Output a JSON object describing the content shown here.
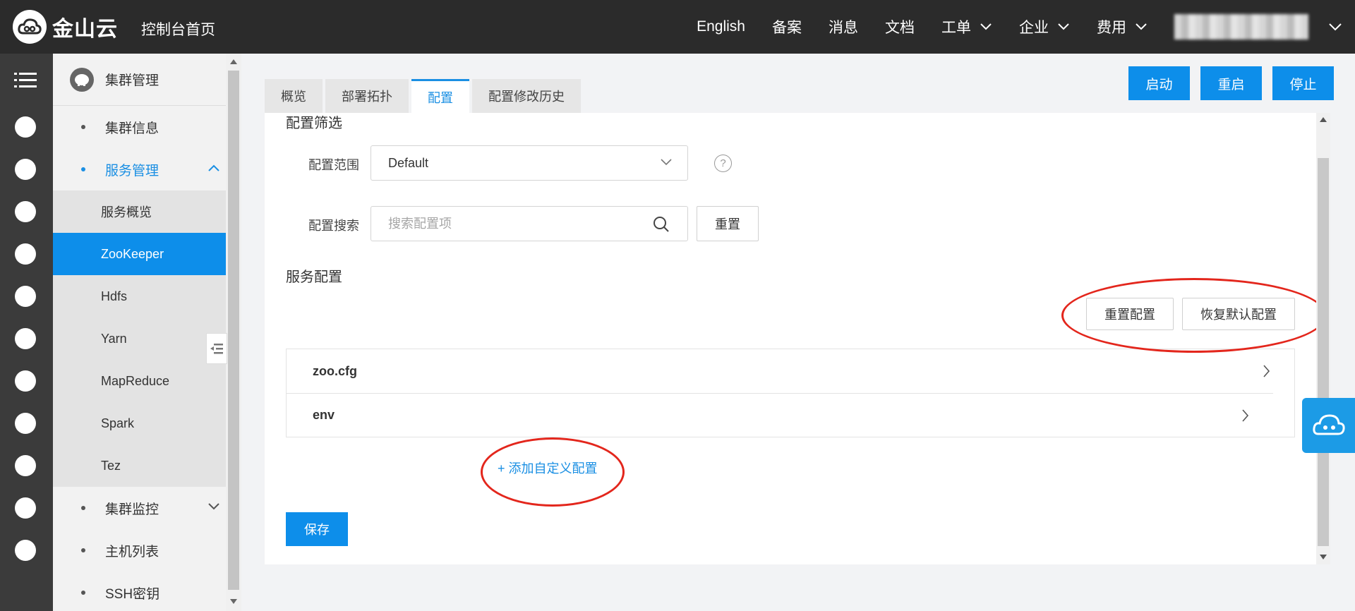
{
  "topbar": {
    "logo_text": "金山云",
    "console_home": "控制台首页",
    "nav": [
      {
        "label": "English",
        "dropdown": false
      },
      {
        "label": "备案",
        "dropdown": false
      },
      {
        "label": "消息",
        "dropdown": false
      },
      {
        "label": "文档",
        "dropdown": false
      },
      {
        "label": "工单",
        "dropdown": true
      },
      {
        "label": "企业",
        "dropdown": true
      },
      {
        "label": "费用",
        "dropdown": true
      }
    ]
  },
  "rail": {
    "icons": [
      "menu-icon",
      "hadoop-icon",
      "database-icon",
      "server-icon",
      "storage-icon",
      "network-icon",
      "share-icon",
      "cloud-icon",
      "layers-icon",
      "cloud-upload-icon",
      "mail-icon",
      "id-card-icon"
    ]
  },
  "sidebar": {
    "header": "集群管理",
    "items": [
      {
        "label": "集群信息",
        "type": "parent"
      },
      {
        "label": "服务管理",
        "type": "parent",
        "expanded": true
      },
      {
        "label": "服务概览",
        "type": "child"
      },
      {
        "label": "ZooKeeper",
        "type": "child",
        "selected": true
      },
      {
        "label": "Hdfs",
        "type": "child"
      },
      {
        "label": "Yarn",
        "type": "child"
      },
      {
        "label": "MapReduce",
        "type": "child"
      },
      {
        "label": "Spark",
        "type": "child"
      },
      {
        "label": "Tez",
        "type": "child"
      },
      {
        "label": "集群监控",
        "type": "parent",
        "expanded": false
      },
      {
        "label": "主机列表",
        "type": "parent"
      },
      {
        "label": "SSH密钥",
        "type": "parent"
      }
    ]
  },
  "tabs": [
    {
      "label": "概览",
      "active": false
    },
    {
      "label": "部署拓扑",
      "active": false
    },
    {
      "label": "配置",
      "active": true
    },
    {
      "label": "配置修改历史",
      "active": false
    }
  ],
  "actions": {
    "start": "启动",
    "restart": "重启",
    "stop": "停止"
  },
  "filter": {
    "title": "配置筛选",
    "scope_label": "配置范围",
    "scope_value": "Default",
    "help": "?",
    "search_label": "配置搜索",
    "search_placeholder": "搜索配置项",
    "reset": "重置"
  },
  "service_config": {
    "title": "服务配置",
    "reset_config": "重置配置",
    "restore_default": "恢复默认配置",
    "files": [
      "zoo.cfg",
      "env"
    ],
    "add_custom": "+ 添加自定义配置",
    "save": "保存"
  },
  "colors": {
    "accent": "#0d8eea",
    "topbar": "#2b2b2b",
    "rail": "#3b3b3b",
    "annotation": "#e3261c"
  }
}
